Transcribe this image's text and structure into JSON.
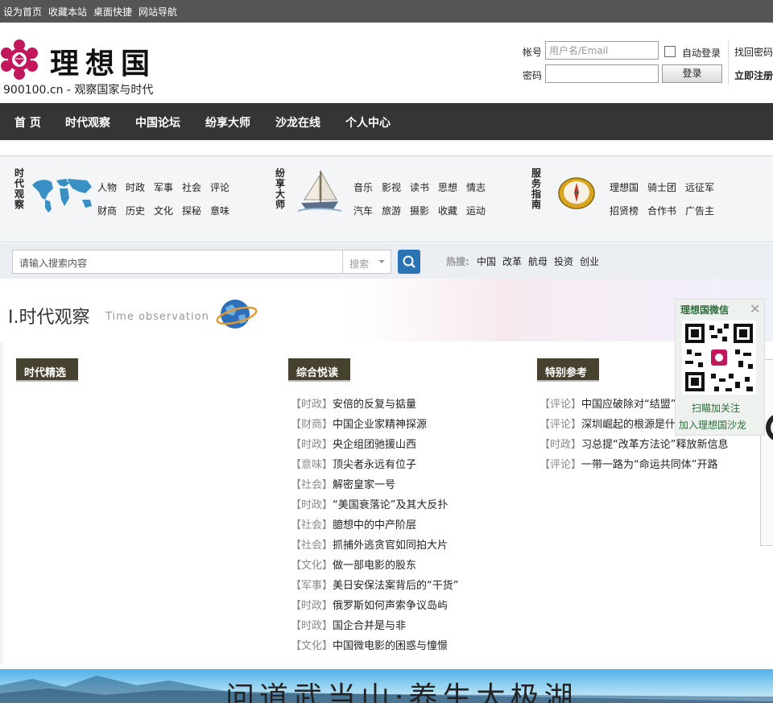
{
  "topbar": {
    "set_home": "设为首页",
    "favorite": "收藏本站",
    "desktop": "桌面快捷",
    "sitemap": "网站导航"
  },
  "brand": {
    "name": "理想国",
    "tagline": "900100.cn - 观察国家与时代"
  },
  "login": {
    "account_label": "帐号",
    "account_placeholder": "用户名/Email",
    "password_label": "密码",
    "auto_login": "自动登录",
    "login_button": "登录",
    "find_password": "找回密码",
    "register": "立即注册"
  },
  "nav": [
    "首 页",
    "时代观察",
    "中国论坛",
    "纷享大师",
    "沙龙在线",
    "个人中心"
  ],
  "categories": {
    "group1": {
      "title": "时代观察",
      "row1": [
        "人物",
        "时政",
        "军事",
        "社会",
        "评论"
      ],
      "row2": [
        "财商",
        "历史",
        "文化",
        "探秘",
        "意味"
      ]
    },
    "group2": {
      "title": "纷享大师",
      "row1": [
        "音乐",
        "影视",
        "读书",
        "思想",
        "情志"
      ],
      "row2": [
        "汽车",
        "旅游",
        "摄影",
        "收藏",
        "运动"
      ]
    },
    "group3": {
      "title": "服务指南",
      "row1": [
        "理想国",
        "骑士团",
        "远征军"
      ],
      "row2": [
        "招贤榜",
        "合作书",
        "广告主"
      ]
    }
  },
  "search": {
    "placeholder": "请输入搜索内容",
    "type": "搜索",
    "hot_label": "热搜:",
    "hot": [
      "中国",
      "改革",
      "航母",
      "投资",
      "创业"
    ]
  },
  "section": {
    "title": "I.时代观察",
    "subtitle": "Time observation"
  },
  "tabs": {
    "left": "时代精选",
    "middle": "综合悦读",
    "right": "特别参考"
  },
  "articles_middle": [
    {
      "tag": "【时政】",
      "title": "安倍的反复与掂量"
    },
    {
      "tag": "【财商】",
      "title": "中国企业家精神探源"
    },
    {
      "tag": "【时政】",
      "title": "央企组团驰援山西"
    },
    {
      "tag": "【意味】",
      "title": "顶尖者永远有位子"
    },
    {
      "tag": "【社会】",
      "title": "解密皇家一号"
    },
    {
      "tag": "【时政】",
      "title": "“美国衰落论”及其大反扑"
    },
    {
      "tag": "【社会】",
      "title": "臆想中的中产阶层"
    },
    {
      "tag": "【社会】",
      "title": "抓捕外逃贪官如同拍大片"
    },
    {
      "tag": "【文化】",
      "title": "做一部电影的股东"
    },
    {
      "tag": "【军事】",
      "title": "美日安保法案背后的“干货”"
    },
    {
      "tag": "【时政】",
      "title": "俄罗斯如何声索争议岛屿"
    },
    {
      "tag": "【时政】",
      "title": "国企合并是与非"
    },
    {
      "tag": "【文化】",
      "title": "中国微电影的困惑与憧憬"
    }
  ],
  "articles_right": [
    {
      "tag": "【评论】",
      "title": "中国应破除对“结盟”的认识误区"
    },
    {
      "tag": "【评论】",
      "title": "深圳崛起的根源是什么"
    },
    {
      "tag": "【时政】",
      "title": "习总提“改革方法论”释放新信息"
    },
    {
      "tag": "【评论】",
      "title": "一带一路为“命运共同体”开路"
    }
  ],
  "wechat": {
    "title": "理想国微信",
    "close": "✕",
    "line1": "扫瞄加关注",
    "line2": "加入理想国沙龙"
  },
  "banner": {
    "text": "问道武当山·养生太极湖"
  }
}
